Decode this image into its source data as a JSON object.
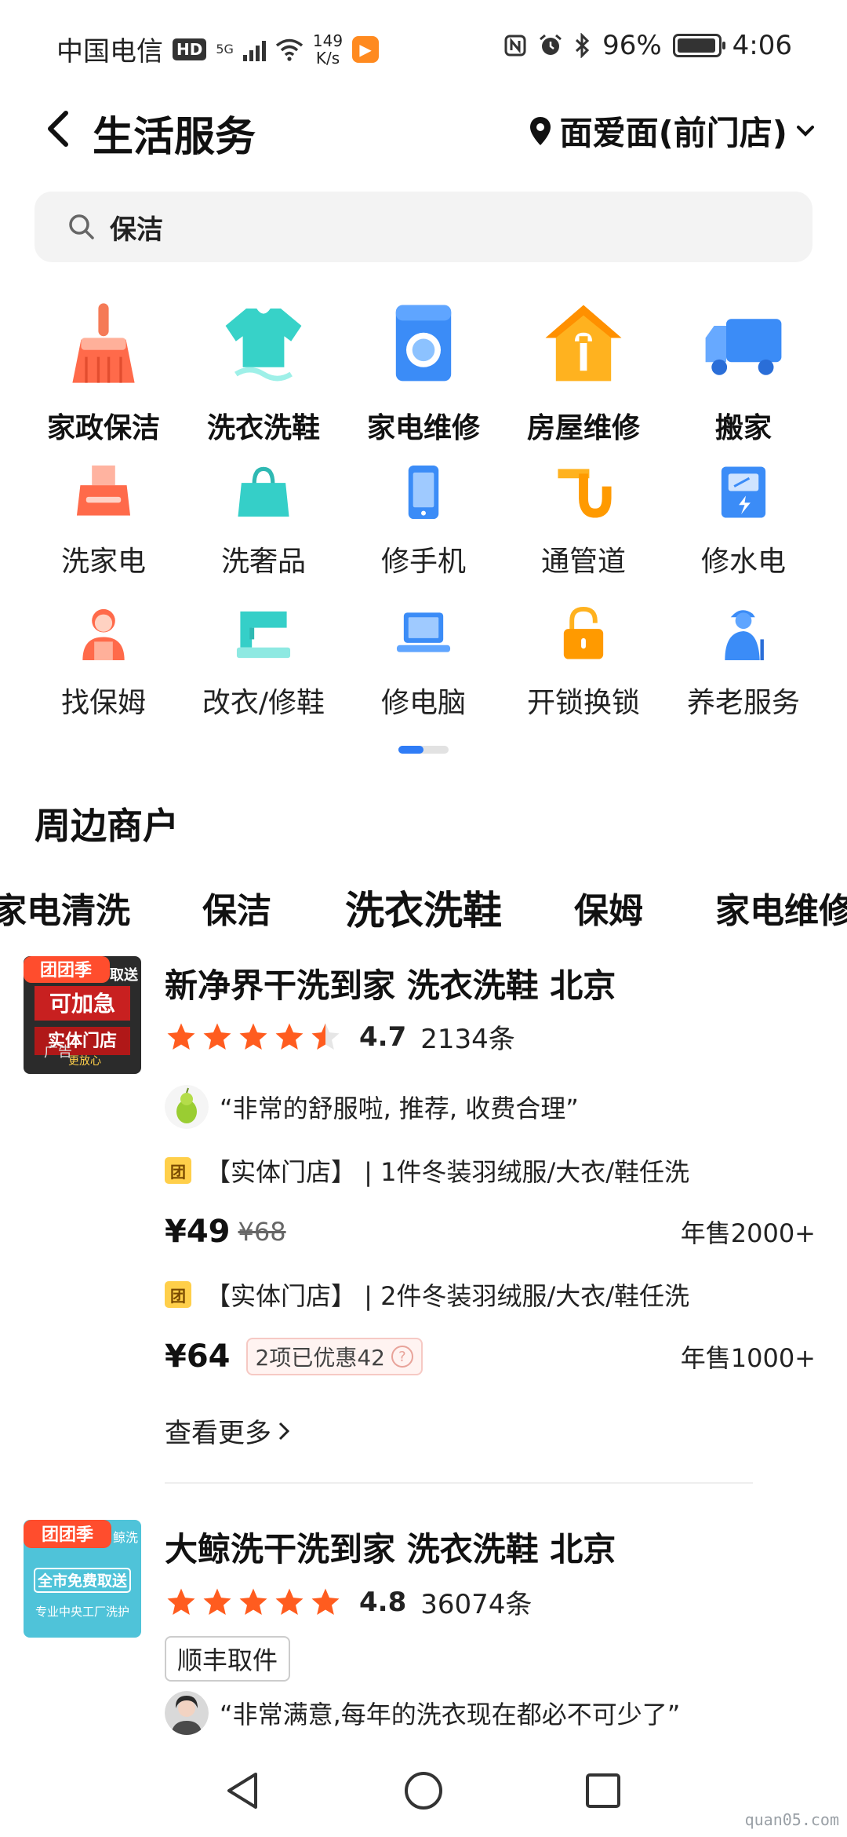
{
  "status_bar": {
    "carrier": "中国电信",
    "hd_badge": "HD",
    "network": "5G",
    "net_speed_value": "149",
    "net_speed_unit": "K/s",
    "battery_percent": "96%",
    "battery_level": 0.96,
    "time": "4:06"
  },
  "header": {
    "title": "生活服务",
    "location": "面爱面(前门店)"
  },
  "search": {
    "value": "保洁"
  },
  "categories": [
    {
      "label": "家政保洁",
      "icon": "broom-icon"
    },
    {
      "label": "洗衣洗鞋",
      "icon": "tshirt-icon"
    },
    {
      "label": "家电维修",
      "icon": "washing-machine-icon"
    },
    {
      "label": "房屋维修",
      "icon": "house-wrench-icon"
    },
    {
      "label": "搬家",
      "icon": "truck-icon"
    },
    {
      "label": "洗家电",
      "icon": "range-hood-icon"
    },
    {
      "label": "洗奢品",
      "icon": "handbag-icon"
    },
    {
      "label": "修手机",
      "icon": "phone-icon"
    },
    {
      "label": "通管道",
      "icon": "pipe-icon"
    },
    {
      "label": "修水电",
      "icon": "meter-icon"
    },
    {
      "label": "找保姆",
      "icon": "nanny-icon"
    },
    {
      "label": "改衣/修鞋",
      "icon": "sewing-machine-icon"
    },
    {
      "label": "修电脑",
      "icon": "laptop-icon"
    },
    {
      "label": "开锁换锁",
      "icon": "lock-icon"
    },
    {
      "label": "养老服务",
      "icon": "elderly-icon"
    }
  ],
  "nearby": {
    "title": "周边商户",
    "tabs": [
      "家电清洗",
      "保洁",
      "洗衣洗鞋",
      "保姆",
      "家电维修"
    ],
    "active_tab": "洗衣洗鞋"
  },
  "merchants": [
    {
      "name": "新净界干洗到家 洗衣洗鞋 北京",
      "rating": "4.7",
      "stars": 4.5,
      "reviews": "2134条",
      "thumb_text": [
        "团团季",
        "取送",
        "可加急",
        "实体门店",
        "更放心"
      ],
      "ad_label": "广告",
      "review": "“非常的舒服啦, 推荐, 收费合理”",
      "deals": [
        {
          "badge": "团",
          "title": "【实体门店】 | 1件冬装羽绒服/大衣/鞋任洗",
          "price": "¥49",
          "orig_price": "¥68",
          "discount": "",
          "sold": "年售2000+"
        },
        {
          "badge": "团",
          "title": "【实体门店】 | 2件冬装羽绒服/大衣/鞋任洗",
          "price": "¥64",
          "orig_price": "",
          "discount": "2项已优惠42",
          "sold": "年售1000+"
        }
      ],
      "see_more": "查看更多"
    },
    {
      "name": "大鲸洗干洗到家 洗衣洗鞋 北京",
      "rating": "4.8",
      "stars": 5,
      "reviews": "36074条",
      "thumb_text": [
        "团团季",
        "鲸洗",
        "全市免费取送",
        "专业中央工厂洗护"
      ],
      "tag": "顺丰取件",
      "review": "“非常满意,每年的洗衣现在都必不可少了”"
    }
  ],
  "watermark": "quan05.com",
  "colors": {
    "accent_blue": "#2f7cf6",
    "star_orange": "#ff5c1f",
    "tab_underline": "#ffd54a",
    "deal_badge": "#ffcf4a"
  }
}
